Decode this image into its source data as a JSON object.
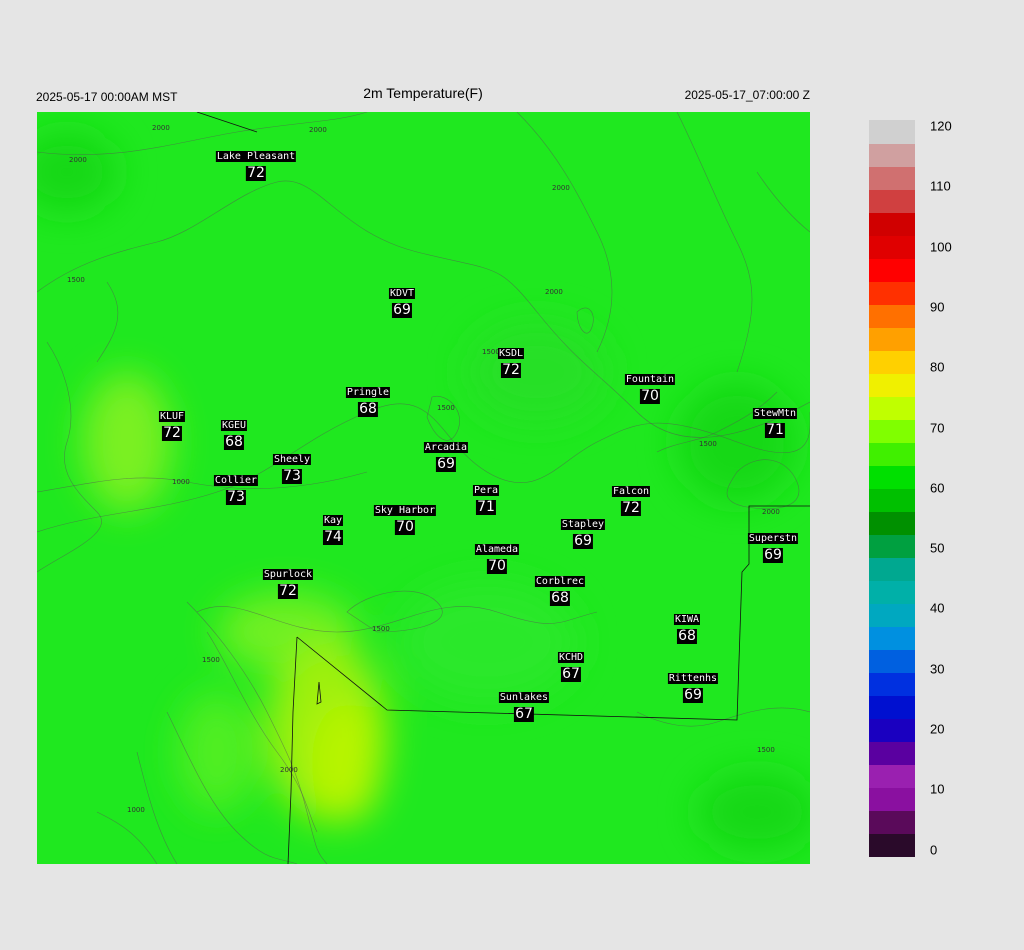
{
  "header": {
    "left_time": "2025-05-17 00:00AM MST",
    "title": "2m Temperature(F)",
    "right_time": "2025-05-17_07:00:00 Z"
  },
  "contour_labels": [
    "2000",
    "2000",
    "2000",
    "2000",
    "1500",
    "1000",
    "1500",
    "1500",
    "1500",
    "2000",
    "1500",
    "1500",
    "2000",
    "1000",
    "1500",
    "2000"
  ],
  "stations": [
    {
      "name": "Lake Pleasant",
      "value": "72"
    },
    {
      "name": "KDVT",
      "value": "69"
    },
    {
      "name": "KSDL",
      "value": "72"
    },
    {
      "name": "Fountain",
      "value": "70"
    },
    {
      "name": "Pringle",
      "value": "68"
    },
    {
      "name": "StewMtn",
      "value": "71"
    },
    {
      "name": "KLUF",
      "value": "72"
    },
    {
      "name": "KGEU",
      "value": "68"
    },
    {
      "name": "Arcadia",
      "value": "69"
    },
    {
      "name": "Sheely",
      "value": "73"
    },
    {
      "name": "Collier",
      "value": "73"
    },
    {
      "name": "Pera",
      "value": "71"
    },
    {
      "name": "Falcon",
      "value": "72"
    },
    {
      "name": "Kay",
      "value": "74"
    },
    {
      "name": "Sky Harbor",
      "value": "70"
    },
    {
      "name": "Stapley",
      "value": "69"
    },
    {
      "name": "Superstn",
      "value": "69"
    },
    {
      "name": "Alameda",
      "value": "70"
    },
    {
      "name": "Spurlock",
      "value": "72"
    },
    {
      "name": "Corblrec",
      "value": "68"
    },
    {
      "name": "KIWA",
      "value": "68"
    },
    {
      "name": "KCHD",
      "value": "67"
    },
    {
      "name": "Rittenhs",
      "value": "69"
    },
    {
      "name": "Sunlakes",
      "value": "67"
    }
  ],
  "colorbar": {
    "ticks": [
      "120",
      "110",
      "100",
      "90",
      "80",
      "70",
      "60",
      "50",
      "40",
      "30",
      "20",
      "10",
      "0"
    ],
    "colors": [
      "#2a0a2a",
      "#5a0a5a",
      "#8a10a0",
      "#9a20b0",
      "#5a00a0",
      "#1a00c0",
      "#0010d0",
      "#0030e0",
      "#0060e0",
      "#0090e0",
      "#00a8c0",
      "#00b0a8",
      "#00a890",
      "#00a040",
      "#009000",
      "#00c000",
      "#00e000",
      "#40f000",
      "#80ff00",
      "#c0ff00",
      "#f0f000",
      "#ffd000",
      "#ffa000",
      "#ff7000",
      "#ff3000",
      "#ff0000",
      "#e00000",
      "#d00000",
      "#d04040",
      "#d07070",
      "#d0a0a0",
      "#d0d0d0"
    ]
  }
}
